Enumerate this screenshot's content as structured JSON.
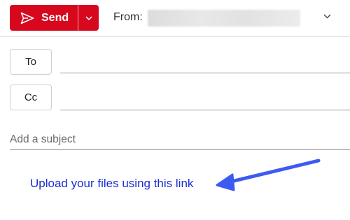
{
  "toolbar": {
    "send_label": "Send",
    "send_icon": "paper-plane-icon",
    "dropdown_icon": "chevron-down-icon"
  },
  "from": {
    "label": "From:",
    "value_redacted": true,
    "chevron_icon": "chevron-down-icon"
  },
  "recipients": {
    "to_label": "To",
    "to_value": "",
    "cc_label": "Cc",
    "cc_value": ""
  },
  "subject": {
    "placeholder": "Add a subject",
    "value": ""
  },
  "body": {
    "link_text": "Upload your files using this link"
  },
  "colors": {
    "send_button": "#d7081e",
    "link": "#1a2dd6",
    "annotation_arrow": "#3d5af1"
  }
}
